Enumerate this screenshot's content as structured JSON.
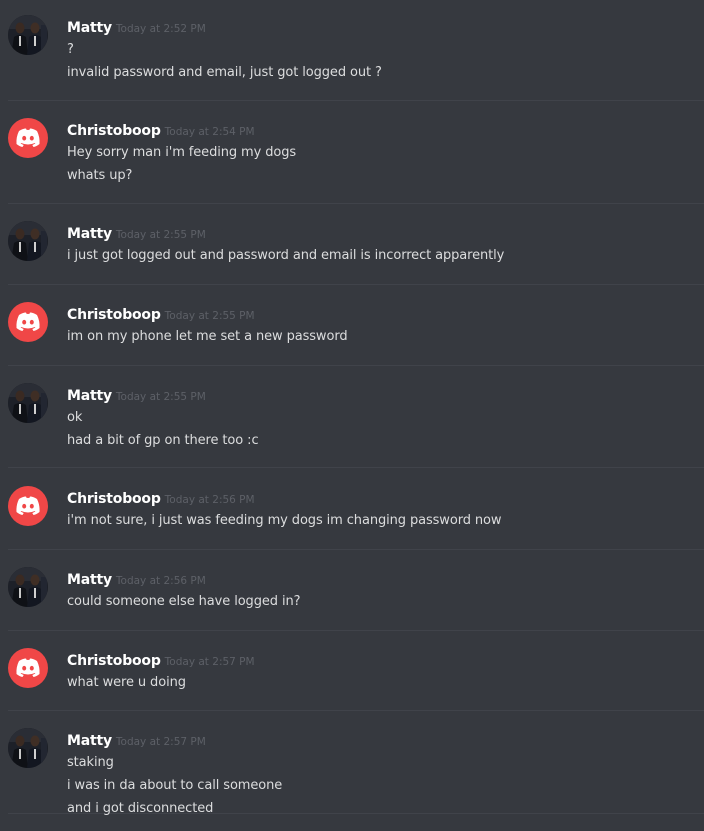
{
  "messages": [
    {
      "author": "Matty",
      "avatar": "matty-avatar",
      "time": "Today at 2:52 PM",
      "lines": [
        "?",
        "invalid password and email, just got logged out ?"
      ]
    },
    {
      "author": "Christoboop",
      "avatar": "discord-logo-avatar",
      "time": "Today at 2:54 PM",
      "lines": [
        "Hey sorry man i'm feeding my dogs",
        "whats up?"
      ]
    },
    {
      "author": "Matty",
      "avatar": "matty-avatar",
      "time": "Today at 2:55 PM",
      "lines": [
        "i just got logged out and password and email is incorrect apparently"
      ]
    },
    {
      "author": "Christoboop",
      "avatar": "discord-logo-avatar",
      "time": "Today at 2:55 PM",
      "lines": [
        "im on my phone let me set a new password"
      ]
    },
    {
      "author": "Matty",
      "avatar": "matty-avatar",
      "time": "Today at 2:55 PM",
      "lines": [
        "ok",
        "had a bit of gp on there too :c"
      ]
    },
    {
      "author": "Christoboop",
      "avatar": "discord-logo-avatar",
      "time": "Today at 2:56 PM",
      "lines": [
        "i'm not sure, i just was feeding my dogs im changing password now"
      ]
    },
    {
      "author": "Matty",
      "avatar": "matty-avatar",
      "time": "Today at 2:56 PM",
      "lines": [
        "could someone else have logged in?"
      ]
    },
    {
      "author": "Christoboop",
      "avatar": "discord-logo-avatar",
      "time": "Today at 2:57 PM",
      "lines": [
        "what were u doing"
      ]
    },
    {
      "author": "Matty",
      "avatar": "matty-avatar",
      "time": "Today at 2:57 PM",
      "lines": [
        "staking",
        "i was in da about to call someone",
        "and i got disconnected"
      ]
    }
  ],
  "colors": {
    "background": "#36393f",
    "username": "#ffffff",
    "timestamp": "#5d6067",
    "message_text": "#dcddde",
    "discord_avatar": "#f04747"
  }
}
